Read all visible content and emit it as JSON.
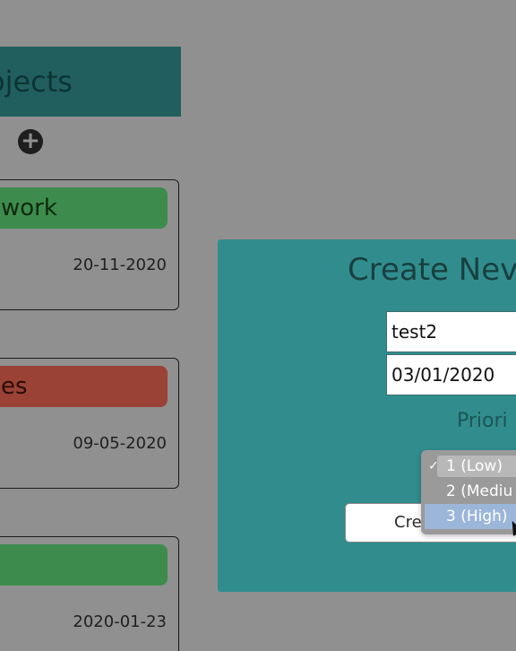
{
  "sidebar": {
    "title": "Projects",
    "title_visible": "ojects",
    "add_icon": "plus-circle-icon",
    "header_color": "#215f5f"
  },
  "projects": [
    {
      "title": "work",
      "date": "20-11-2020",
      "color": "#3d8c4d"
    },
    {
      "title": "es",
      "date": "09-05-2020",
      "color": "#9a4236"
    },
    {
      "title": "",
      "date": "2020-01-23",
      "color": "#3d8c4d"
    }
  ],
  "modal": {
    "title": "Create Nev",
    "name_value": "test2",
    "date_value": "03/01/2020",
    "priority_label": "Priori",
    "create_button": "Create Project",
    "background": "#318d8d"
  },
  "priority_dropdown": {
    "options": [
      {
        "label": "1 (Low)",
        "checked": true
      },
      {
        "label": "2 (Mediu",
        "checked": false
      },
      {
        "label": "3 (High)",
        "checked": false
      }
    ],
    "check_mark": "✓",
    "hover_index": 2
  }
}
